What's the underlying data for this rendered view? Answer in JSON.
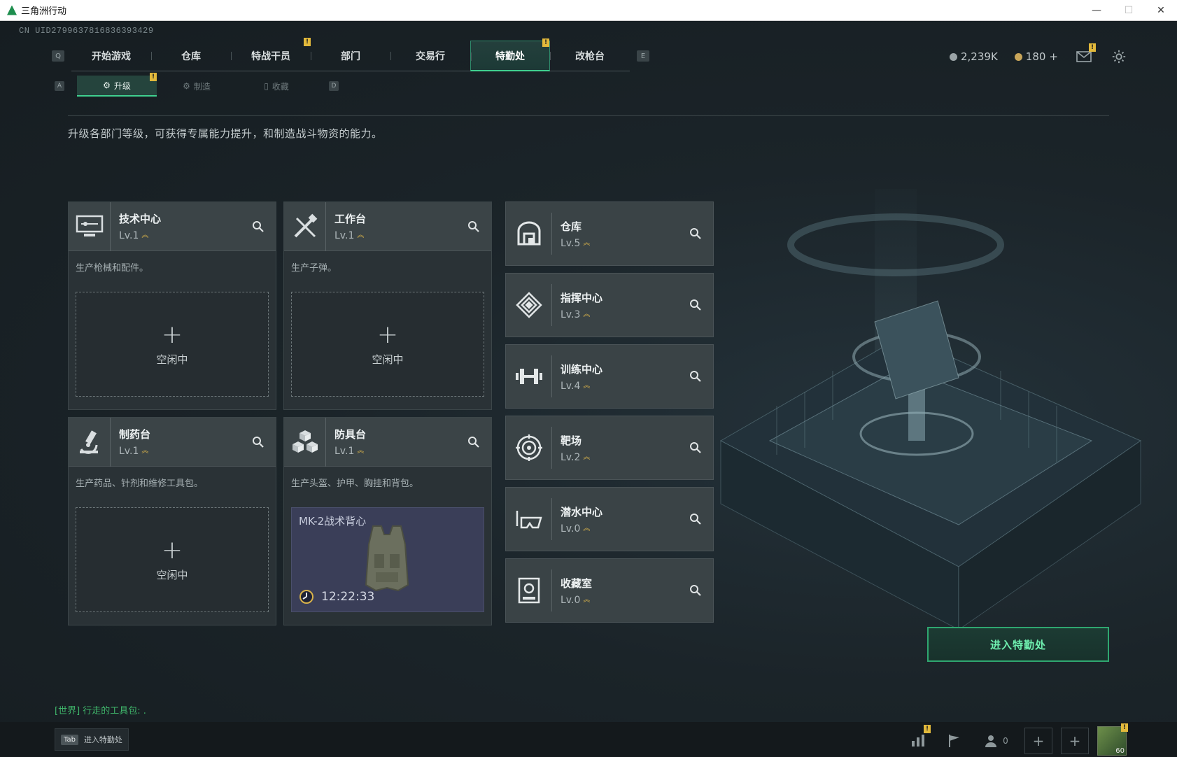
{
  "window": {
    "title": "三角洲行动",
    "minimize": "—",
    "maximize": "☐",
    "close": "✕"
  },
  "uid": "CN UID2799637816836393429",
  "nav": {
    "key_left": "Q",
    "key_right": "E",
    "tabs": [
      {
        "label": "开始游戏",
        "badge": ""
      },
      {
        "label": "仓库",
        "badge": ""
      },
      {
        "label": "特战干员",
        "badge": "!"
      },
      {
        "label": "部门",
        "badge": ""
      },
      {
        "label": "交易行",
        "badge": ""
      },
      {
        "label": "特勤处",
        "badge": "!",
        "active": true
      },
      {
        "label": "改枪台",
        "badge": ""
      }
    ]
  },
  "currency": {
    "silver": "2,239K",
    "gold": "180",
    "gold_add": "+"
  },
  "subnav": {
    "key_left": "A",
    "key_right": "D",
    "tabs": [
      {
        "label": "升级",
        "active": true,
        "badge": "!"
      },
      {
        "label": "制造"
      },
      {
        "label": "收藏"
      }
    ]
  },
  "description": "升级各部门等级，可获得专属能力提升，和制造战斗物资的能力。",
  "production_depts": [
    {
      "name": "技术中心",
      "level": "Lv.1",
      "desc": "生产枪械和配件。",
      "slot_plus": "+",
      "slot_status": "空闲中",
      "icon": "monitor-icon"
    },
    {
      "name": "工作台",
      "level": "Lv.1",
      "desc": "生产子弹。",
      "slot_plus": "+",
      "slot_status": "空闲中",
      "icon": "tools-icon"
    },
    {
      "name": "制药台",
      "level": "Lv.1",
      "desc": "生产药品、针剂和维修工具包。",
      "slot_plus": "+",
      "slot_status": "空闲中",
      "icon": "microscope-icon"
    },
    {
      "name": "防具台",
      "level": "Lv.1",
      "desc": "生产头盔、护甲、胸挂和背包。",
      "item_name": "MK-2战术背心",
      "timer": "12:22:33",
      "icon": "boxes-icon"
    }
  ],
  "facilities": [
    {
      "name": "仓库",
      "level": "Lv.5",
      "icon": "warehouse-icon"
    },
    {
      "name": "指挥中心",
      "level": "Lv.3",
      "icon": "command-icon"
    },
    {
      "name": "训练中心",
      "level": "Lv.4",
      "icon": "dumbbell-icon"
    },
    {
      "name": "靶场",
      "level": "Lv.2",
      "icon": "target-icon"
    },
    {
      "name": "潜水中心",
      "level": "Lv.0",
      "icon": "diving-icon"
    },
    {
      "name": "收藏室",
      "level": "Lv.0",
      "icon": "vault-icon"
    }
  ],
  "enter_button": "进入特勤处",
  "chat": "[世界] 行走的工具包: .",
  "bottom": {
    "tab_key": "Tab",
    "tab_label": "进入特勤处",
    "friends_count": "0",
    "avatar_level": "60"
  },
  "colors": {
    "accent": "#3fd08f",
    "badge": "#e2b93b",
    "level_chevron": "#d8b24a"
  }
}
